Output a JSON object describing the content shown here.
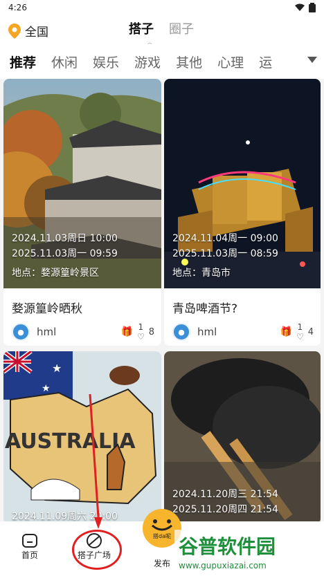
{
  "status": {
    "time": "4:26"
  },
  "location": {
    "label": "全国"
  },
  "top_tabs": [
    {
      "label": "搭子"
    },
    {
      "label": "圈子"
    }
  ],
  "categories": [
    "推荐",
    "休闲",
    "娱乐",
    "游戏",
    "其他",
    "心理",
    "运"
  ],
  "cards": [
    {
      "date1": "2024.11.03周日 10:00",
      "date2": "2025.11.03周一 09:59",
      "place": "地点：婺源篁岭景区",
      "title": "婺源篁岭晒秋",
      "author": "hml",
      "coins": "1",
      "likes": "8"
    },
    {
      "date1": "2024.11.04周一 09:00",
      "date2": "2025.11.03周一 08:59",
      "place": "地点：青岛市",
      "title": "青岛啤酒节?",
      "author": "hml",
      "coins": "1",
      "likes": "4"
    },
    {
      "date1": "2024.11.09周六 20:00",
      "title_art": "AUSTRALIA"
    },
    {
      "date1": "2024.11.20周三 21:54",
      "date2": "2025.11.20周四 21:54"
    }
  ],
  "nav": {
    "home": "首页",
    "plaza": "搭子广场",
    "publish": "发布",
    "publish_logo": "搭da呢"
  },
  "watermark": {
    "line1": "谷普软件园",
    "line2": "www.gupuxiazai.com"
  }
}
